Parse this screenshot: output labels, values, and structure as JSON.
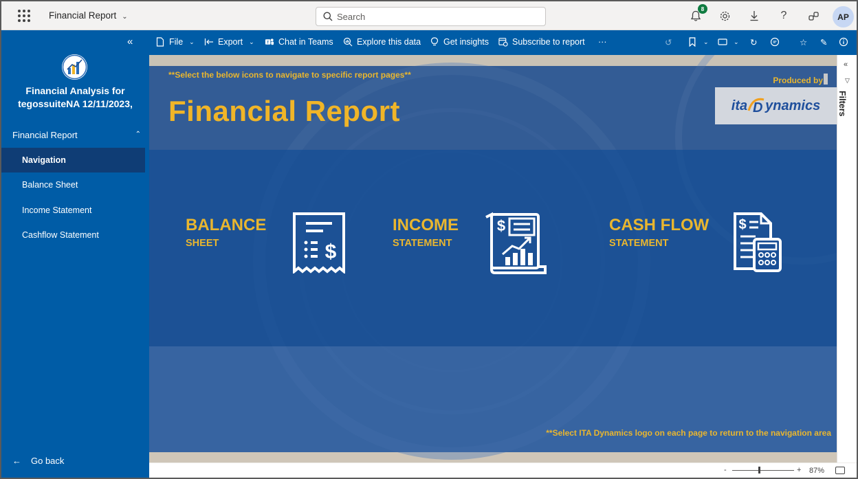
{
  "topbar": {
    "app_title": "Financial Report",
    "search_placeholder": "Search",
    "notification_count": "8",
    "avatar_initials": "AP"
  },
  "nav": {
    "workspace_title_line1": "Financial Analysis for",
    "workspace_title_line2": "tegossuiteNA 12/11/2023,",
    "section_label": "Financial Report",
    "items": [
      {
        "label": "Navigation",
        "selected": true
      },
      {
        "label": "Balance Sheet",
        "selected": false
      },
      {
        "label": "Income Statement",
        "selected": false
      },
      {
        "label": "Cashflow Statement",
        "selected": false
      }
    ],
    "go_back_label": "Go back"
  },
  "actionbar": {
    "file": "File",
    "export": "Export",
    "chat_in_teams": "Chat in Teams",
    "explore": "Explore this data",
    "insights": "Get insights",
    "subscribe": "Subscribe to report",
    "more": "···"
  },
  "report": {
    "hint_top": "**Select the below icons to navigate to specific report pages**",
    "title": "Financial Report",
    "produced_by": "Produced by",
    "logo_ita": "ita",
    "logo_dynamics": "ynamics",
    "logo_d": "D",
    "cards": [
      {
        "main": "BALANCE",
        "sub": "SHEET"
      },
      {
        "main": "INCOME",
        "sub": "STATEMENT"
      },
      {
        "main": "CASH FLOW",
        "sub": "STATEMENT"
      }
    ],
    "hint_bottom": "**Select ITA Dynamics logo on each page to return to the navigation area"
  },
  "filters": {
    "label": "Filters"
  },
  "status": {
    "zoom": "87%",
    "zoom_level": 0.43
  },
  "colors": {
    "nav_blue": "#005ca6",
    "gold": "#e9b62f",
    "selected": "#0f3d75"
  }
}
